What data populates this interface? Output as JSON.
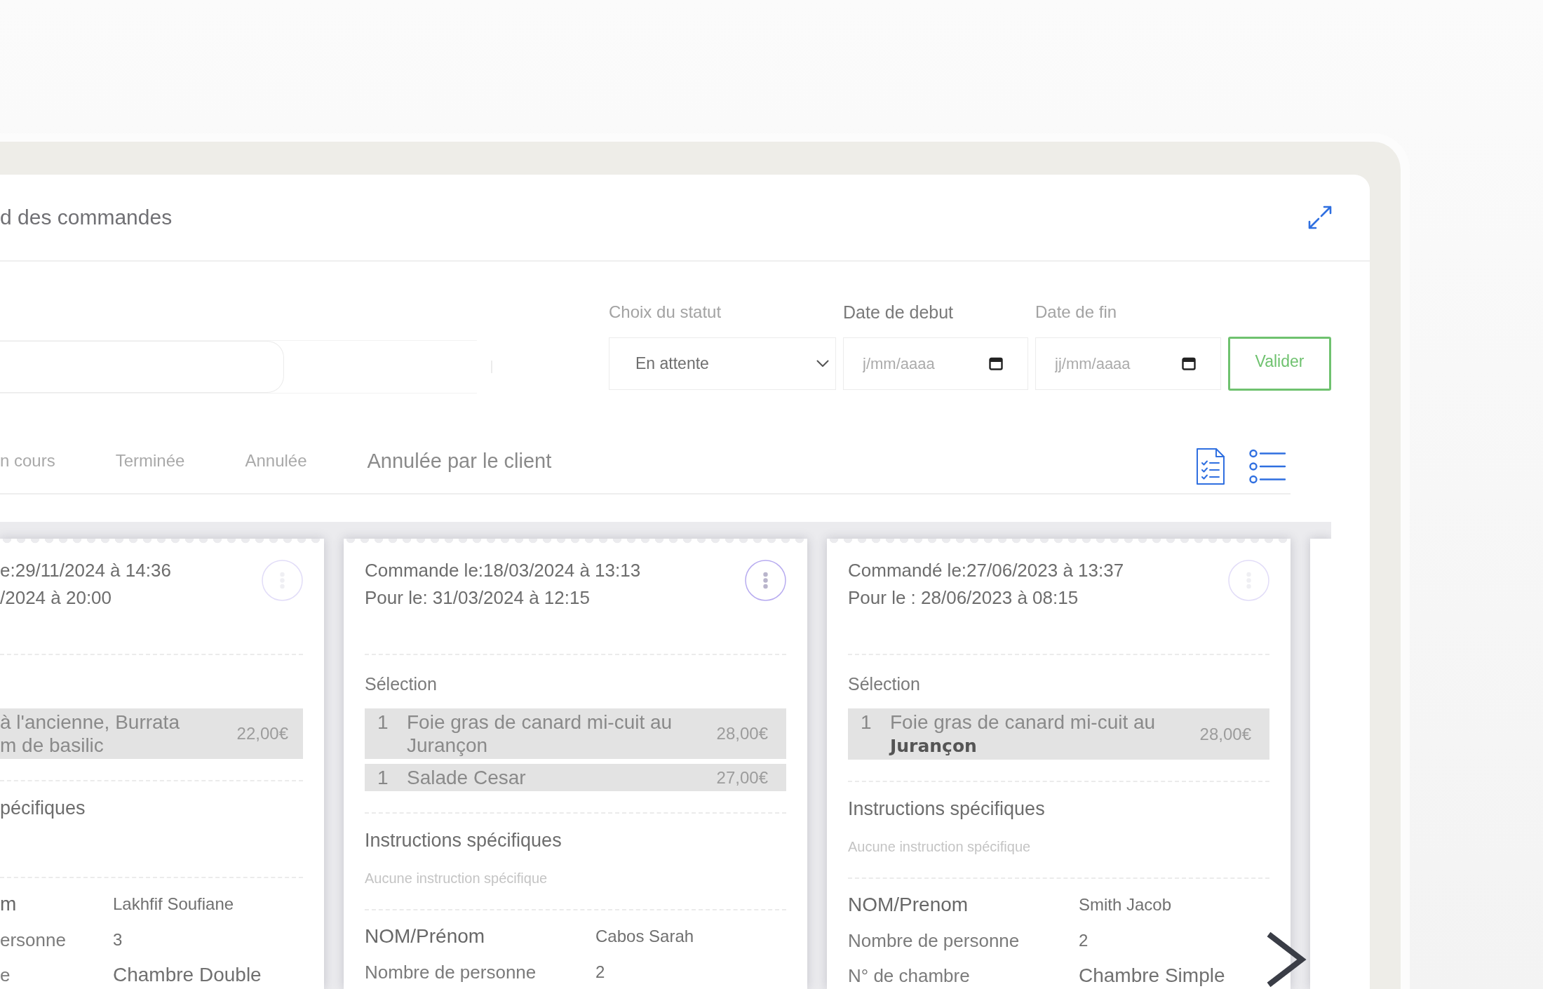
{
  "header": {
    "title": "d des commandes"
  },
  "filters": {
    "status": {
      "label": "Choix du statut",
      "value": "En attente"
    },
    "start_date": {
      "label": "Date de debut",
      "placeholder": "j/mm/aaaa"
    },
    "end_date": {
      "label": "Date de fin",
      "placeholder": "jj/mm/aaaa"
    },
    "submit": "Valider"
  },
  "tabs": [
    {
      "label": "n cours",
      "selected": false
    },
    {
      "label": "Terminée",
      "selected": false
    },
    {
      "label": "Annulée",
      "selected": false
    },
    {
      "label": "Annulée par le client",
      "selected": true
    }
  ],
  "orders": [
    {
      "kind": "clipped",
      "ordered_at": "e:29/11/2024 à 14:36",
      "deliver_at": "/2024 à 20:00",
      "info_dimmed": true,
      "items": [
        {
          "name": "à l'ancienne, Burrata\nm de basilic",
          "price": "22,00€"
        }
      ],
      "instructions_title": "pécifiques",
      "fields": [
        {
          "label": "m",
          "value": "Lakhfif Soufiane"
        },
        {
          "label": "ersonne",
          "value": "3"
        },
        {
          "label": "e",
          "value": "Chambre Double"
        }
      ]
    },
    {
      "kind": "full",
      "ordered_at": "Commande le:18/03/2024 à 13:13",
      "deliver_at": "Pour le: 31/03/2024 à 12:15",
      "info_dimmed": false,
      "selection_title": "Sélection",
      "items": [
        {
          "qty": "1",
          "name": "Foie gras de canard mi-cuit au Jurançon",
          "price": "28,00€"
        },
        {
          "qty": "1",
          "name": "Salade Cesar",
          "price": "27,00€"
        }
      ],
      "instructions_title": "Instructions spécifiques",
      "instructions_note": "Aucune instruction spécifique",
      "fields": [
        {
          "label": "NOM/Prénom",
          "value": "Cabos Sarah"
        },
        {
          "label": "Nombre de personne",
          "value": "2"
        }
      ]
    },
    {
      "kind": "full",
      "ordered_at": "Commandé le:27/06/2023 à 13:37",
      "deliver_at": "Pour le : 28/06/2023 à 08:15",
      "info_dimmed": true,
      "selection_title": "Sélection",
      "items": [
        {
          "qty": "1",
          "name": "Foie gras de canard mi-cuit au **Jurançon**",
          "price": "28,00€"
        }
      ],
      "instructions_title": "Instructions spécifiques",
      "instructions_note": "Aucune instruction spécifique",
      "fields": [
        {
          "label": "NOM/Prenom",
          "value": "Smith Jacob"
        },
        {
          "label": "Nombre de personne",
          "value": "2"
        },
        {
          "label": "N° de chambre",
          "value": "Chambre Simple"
        }
      ]
    }
  ]
}
